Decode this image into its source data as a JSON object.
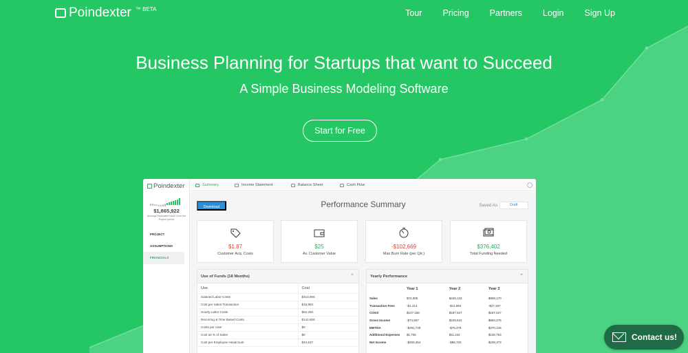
{
  "brand": {
    "name": "Poindexter",
    "suffix": "™ BETA"
  },
  "nav": [
    "Tour",
    "Pricing",
    "Partners",
    "Login",
    "Sign Up"
  ],
  "hero": {
    "title": "Business Planning for Startups that want to Succeed",
    "subtitle": "A Simple Business Modeling Software",
    "cta": "Start for Free"
  },
  "app": {
    "logo": "Poindexter",
    "tabs": [
      "Summary",
      "Income Statement",
      "Balance Sheet",
      "Cash Flow"
    ],
    "sidebar": {
      "value": "$1,865,922",
      "caption": "Average Estimated Value Over the Project period",
      "items": [
        "PROJECT",
        "ASSUMPTIONS",
        "FINANCIALS"
      ]
    },
    "download": "Download",
    "title": "Performance Summary",
    "saved_as": "Saved As",
    "draft": "Draft",
    "metrics": [
      {
        "value": "$1.87",
        "label": "Customer Acq. Costs",
        "icon": "tag-icon"
      },
      {
        "value": "$25",
        "label": "Av. Customer Value",
        "icon": "wallet-icon"
      },
      {
        "value": "-$102,669",
        "label": "Max Burn Rate (per Qtr.)",
        "icon": "stopwatch-icon"
      },
      {
        "value": "$376,402",
        "label": "Total Funding Needed",
        "icon": "money-icon"
      }
    ],
    "funds": {
      "title": "Use of Funds (18 Months)",
      "headers": [
        "Use",
        "Cost"
      ],
      "rows": [
        [
          "Salaried Labor Costs",
          "$313,906"
        ],
        [
          "Cost per Sales Transaction",
          "$15,883"
        ],
        [
          "Hourly Labor Costs",
          "$62,250"
        ],
        [
          "Recurring & Time Based Costs",
          "$142,606"
        ],
        [
          "Costs per User",
          "$0"
        ],
        [
          "Cost as % of Sales",
          "$0"
        ],
        [
          "Cost per Employee Headcount",
          "$34,637"
        ]
      ]
    },
    "yearly": {
      "title": "Yearly Performance",
      "headers": [
        "",
        "Year 1",
        "Year 2",
        "Year 3"
      ],
      "rows": [
        [
          "Sales",
          "$74,005",
          "$429,133",
          "$908,170"
        ],
        [
          "Transaction Fees",
          "-$1,414",
          "-$11,984",
          "-$27,267"
        ],
        [
          "COGS",
          "$147,158",
          "$187,627",
          "$187,627"
        ],
        [
          "Gross Income",
          "-$74,567",
          "$229,522",
          "$693,276"
        ],
        [
          "EBITDA",
          "-$291,749",
          "-$75,478",
          "$370,126"
        ],
        [
          "Additional Expenses",
          "$1,706",
          "$11,242",
          "$130,753"
        ],
        [
          "Net Income",
          "-$293,454",
          "-$86,720",
          "$239,373"
        ]
      ]
    }
  },
  "contact": "Contact us!",
  "colors": {
    "bg": "#24c763",
    "accent_dark": "#1f6b45",
    "blue": "#2d8fd9",
    "red": "#e33b2f"
  }
}
